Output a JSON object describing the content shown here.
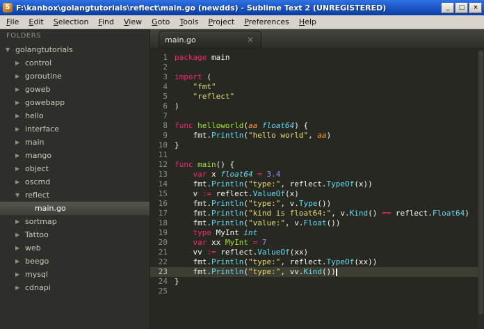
{
  "window": {
    "icon_glyph": "S",
    "title": "F:\\kanbox\\golangtutorials\\reflect\\main.go (newdds) - Sublime Text 2 (UNREGISTERED)",
    "controls": {
      "minimize": "_",
      "maximize": "□",
      "close": "×"
    }
  },
  "menu": {
    "items": [
      "File",
      "Edit",
      "Selection",
      "Find",
      "View",
      "Goto",
      "Tools",
      "Project",
      "Preferences",
      "Help"
    ]
  },
  "sidebar": {
    "header": "FOLDERS",
    "tree": [
      {
        "label": "golangtutorials",
        "depth": 0,
        "type": "folder",
        "expanded": true
      },
      {
        "label": "control",
        "depth": 1,
        "type": "folder",
        "expanded": false
      },
      {
        "label": "goroutine",
        "depth": 1,
        "type": "folder",
        "expanded": false
      },
      {
        "label": "goweb",
        "depth": 1,
        "type": "folder",
        "expanded": false
      },
      {
        "label": "gowebapp",
        "depth": 1,
        "type": "folder",
        "expanded": false
      },
      {
        "label": "hello",
        "depth": 1,
        "type": "folder",
        "expanded": false
      },
      {
        "label": "interface",
        "depth": 1,
        "type": "folder",
        "expanded": false
      },
      {
        "label": "main",
        "depth": 1,
        "type": "folder",
        "expanded": false
      },
      {
        "label": "mango",
        "depth": 1,
        "type": "folder",
        "expanded": false
      },
      {
        "label": "object",
        "depth": 1,
        "type": "folder",
        "expanded": false
      },
      {
        "label": "oscmd",
        "depth": 1,
        "type": "folder",
        "expanded": false
      },
      {
        "label": "reflect",
        "depth": 1,
        "type": "folder",
        "expanded": true
      },
      {
        "label": "main.go",
        "depth": 2,
        "type": "file",
        "selected": true
      },
      {
        "label": "sortmap",
        "depth": 1,
        "type": "folder",
        "expanded": false
      },
      {
        "label": "Tattoo",
        "depth": 1,
        "type": "folder",
        "expanded": false
      },
      {
        "label": "web",
        "depth": 1,
        "type": "folder",
        "expanded": false
      },
      {
        "label": "beego",
        "depth": 1,
        "type": "folder",
        "expanded": false
      },
      {
        "label": "mysql",
        "depth": 1,
        "type": "folder",
        "expanded": false
      },
      {
        "label": "cdnapi",
        "depth": 1,
        "type": "folder",
        "expanded": false
      }
    ]
  },
  "editor": {
    "tab": {
      "label": "main.go",
      "close": "×"
    },
    "language": "Go",
    "lines": [
      {
        "num": 1,
        "segments": [
          {
            "c": "k",
            "t": "package"
          },
          {
            "c": "p",
            "t": " main"
          }
        ]
      },
      {
        "num": 2,
        "segments": []
      },
      {
        "num": 3,
        "segments": [
          {
            "c": "k",
            "t": "import"
          },
          {
            "c": "p",
            "t": " ("
          }
        ]
      },
      {
        "num": 4,
        "segments": [
          {
            "c": "p",
            "t": "    "
          },
          {
            "c": "s",
            "t": "\"fmt\""
          }
        ]
      },
      {
        "num": 5,
        "segments": [
          {
            "c": "p",
            "t": "    "
          },
          {
            "c": "s",
            "t": "\"reflect\""
          }
        ]
      },
      {
        "num": 6,
        "segments": [
          {
            "c": "p",
            "t": ")"
          }
        ]
      },
      {
        "num": 7,
        "segments": []
      },
      {
        "num": 8,
        "segments": [
          {
            "c": "k",
            "t": "func"
          },
          {
            "c": "p",
            "t": " "
          },
          {
            "c": "f",
            "t": "helloworld"
          },
          {
            "c": "p",
            "t": "("
          },
          {
            "c": "a",
            "t": "aa"
          },
          {
            "c": "p",
            "t": " "
          },
          {
            "c": "t",
            "t": "float64"
          },
          {
            "c": "p",
            "t": ") {"
          }
        ]
      },
      {
        "num": 9,
        "segments": [
          {
            "c": "p",
            "t": "    fmt."
          },
          {
            "c": "c",
            "t": "Println"
          },
          {
            "c": "p",
            "t": "("
          },
          {
            "c": "s",
            "t": "\"hello world\""
          },
          {
            "c": "p",
            "t": ", "
          },
          {
            "c": "a",
            "t": "aa"
          },
          {
            "c": "p",
            "t": ")"
          }
        ]
      },
      {
        "num": 10,
        "segments": [
          {
            "c": "p",
            "t": "}"
          }
        ]
      },
      {
        "num": 11,
        "segments": []
      },
      {
        "num": 12,
        "segments": [
          {
            "c": "k",
            "t": "func"
          },
          {
            "c": "p",
            "t": " "
          },
          {
            "c": "f",
            "t": "main"
          },
          {
            "c": "p",
            "t": "() {"
          }
        ]
      },
      {
        "num": 13,
        "segments": [
          {
            "c": "p",
            "t": "    "
          },
          {
            "c": "k",
            "t": "var"
          },
          {
            "c": "p",
            "t": " x "
          },
          {
            "c": "t",
            "t": "float64"
          },
          {
            "c": "p",
            "t": " "
          },
          {
            "c": "k",
            "t": "="
          },
          {
            "c": "p",
            "t": " "
          },
          {
            "c": "n",
            "t": "3.4"
          }
        ]
      },
      {
        "num": 14,
        "segments": [
          {
            "c": "p",
            "t": "    fmt."
          },
          {
            "c": "c",
            "t": "Println"
          },
          {
            "c": "p",
            "t": "("
          },
          {
            "c": "s",
            "t": "\"type:\""
          },
          {
            "c": "p",
            "t": ", reflect."
          },
          {
            "c": "c",
            "t": "TypeOf"
          },
          {
            "c": "p",
            "t": "(x))"
          }
        ]
      },
      {
        "num": 15,
        "segments": [
          {
            "c": "p",
            "t": "    v "
          },
          {
            "c": "k",
            "t": ":="
          },
          {
            "c": "p",
            "t": " reflect."
          },
          {
            "c": "c",
            "t": "ValueOf"
          },
          {
            "c": "p",
            "t": "(x)"
          }
        ]
      },
      {
        "num": 16,
        "segments": [
          {
            "c": "p",
            "t": "    fmt."
          },
          {
            "c": "c",
            "t": "Println"
          },
          {
            "c": "p",
            "t": "("
          },
          {
            "c": "s",
            "t": "\"type:\""
          },
          {
            "c": "p",
            "t": ", v."
          },
          {
            "c": "c",
            "t": "Type"
          },
          {
            "c": "p",
            "t": "())"
          }
        ]
      },
      {
        "num": 17,
        "segments": [
          {
            "c": "p",
            "t": "    fmt."
          },
          {
            "c": "c",
            "t": "Println"
          },
          {
            "c": "p",
            "t": "("
          },
          {
            "c": "s",
            "t": "\"kind is float64:\""
          },
          {
            "c": "p",
            "t": ", v."
          },
          {
            "c": "c",
            "t": "Kind"
          },
          {
            "c": "p",
            "t": "() "
          },
          {
            "c": "k",
            "t": "=="
          },
          {
            "c": "p",
            "t": " reflect."
          },
          {
            "c": "c",
            "t": "Float64"
          },
          {
            "c": "p",
            "t": ")"
          }
        ]
      },
      {
        "num": 18,
        "segments": [
          {
            "c": "p",
            "t": "    fmt."
          },
          {
            "c": "c",
            "t": "Println"
          },
          {
            "c": "p",
            "t": "("
          },
          {
            "c": "s",
            "t": "\"value:\""
          },
          {
            "c": "p",
            "t": ", v."
          },
          {
            "c": "c",
            "t": "Float"
          },
          {
            "c": "p",
            "t": "())"
          }
        ]
      },
      {
        "num": 19,
        "segments": [
          {
            "c": "p",
            "t": "    "
          },
          {
            "c": "k",
            "t": "type"
          },
          {
            "c": "p",
            "t": " MyInt "
          },
          {
            "c": "t",
            "t": "int"
          }
        ]
      },
      {
        "num": 20,
        "segments": [
          {
            "c": "p",
            "t": "    "
          },
          {
            "c": "k",
            "t": "var"
          },
          {
            "c": "p",
            "t": " xx "
          },
          {
            "c": "g",
            "t": "MyInt"
          },
          {
            "c": "p",
            "t": " "
          },
          {
            "c": "k",
            "t": "="
          },
          {
            "c": "p",
            "t": " "
          },
          {
            "c": "n",
            "t": "7"
          }
        ]
      },
      {
        "num": 21,
        "segments": [
          {
            "c": "p",
            "t": "    vv "
          },
          {
            "c": "k",
            "t": ":="
          },
          {
            "c": "p",
            "t": " reflect."
          },
          {
            "c": "c",
            "t": "ValueOf"
          },
          {
            "c": "p",
            "t": "(xx)"
          }
        ]
      },
      {
        "num": 22,
        "segments": [
          {
            "c": "p",
            "t": "    fmt."
          },
          {
            "c": "c",
            "t": "Println"
          },
          {
            "c": "p",
            "t": "("
          },
          {
            "c": "s",
            "t": "\"type:\""
          },
          {
            "c": "p",
            "t": ", reflect."
          },
          {
            "c": "c",
            "t": "TypeOf"
          },
          {
            "c": "p",
            "t": "(xx))"
          }
        ]
      },
      {
        "num": 23,
        "current": true,
        "cursor": true,
        "segments": [
          {
            "c": "p",
            "t": "    fmt."
          },
          {
            "c": "c",
            "t": "Println"
          },
          {
            "c": "p",
            "t": "("
          },
          {
            "c": "s",
            "t": "\"type:\""
          },
          {
            "c": "p",
            "t": ", vv."
          },
          {
            "c": "c",
            "t": "Kind"
          },
          {
            "c": "p",
            "t": "())"
          }
        ]
      },
      {
        "num": 24,
        "segments": [
          {
            "c": "p",
            "t": "}"
          }
        ]
      },
      {
        "num": 25,
        "segments": []
      }
    ]
  },
  "theme": {
    "titlebar_blue": "#1a53c2",
    "menubar_bg": "#d8d4cc",
    "sidebar_bg": "#2e2e2a",
    "editor_bg": "#272822",
    "current_line_bg": "#3e3d32",
    "text": "#f8f8f2",
    "keyword": "#f92672",
    "string": "#e6db74",
    "number": "#ae81ff",
    "function_name": "#a6e22e",
    "support_function": "#66d9ef",
    "type_italic": "#66d9ef",
    "parameter": "#fd971f",
    "gutter_number": "#8f908a"
  }
}
